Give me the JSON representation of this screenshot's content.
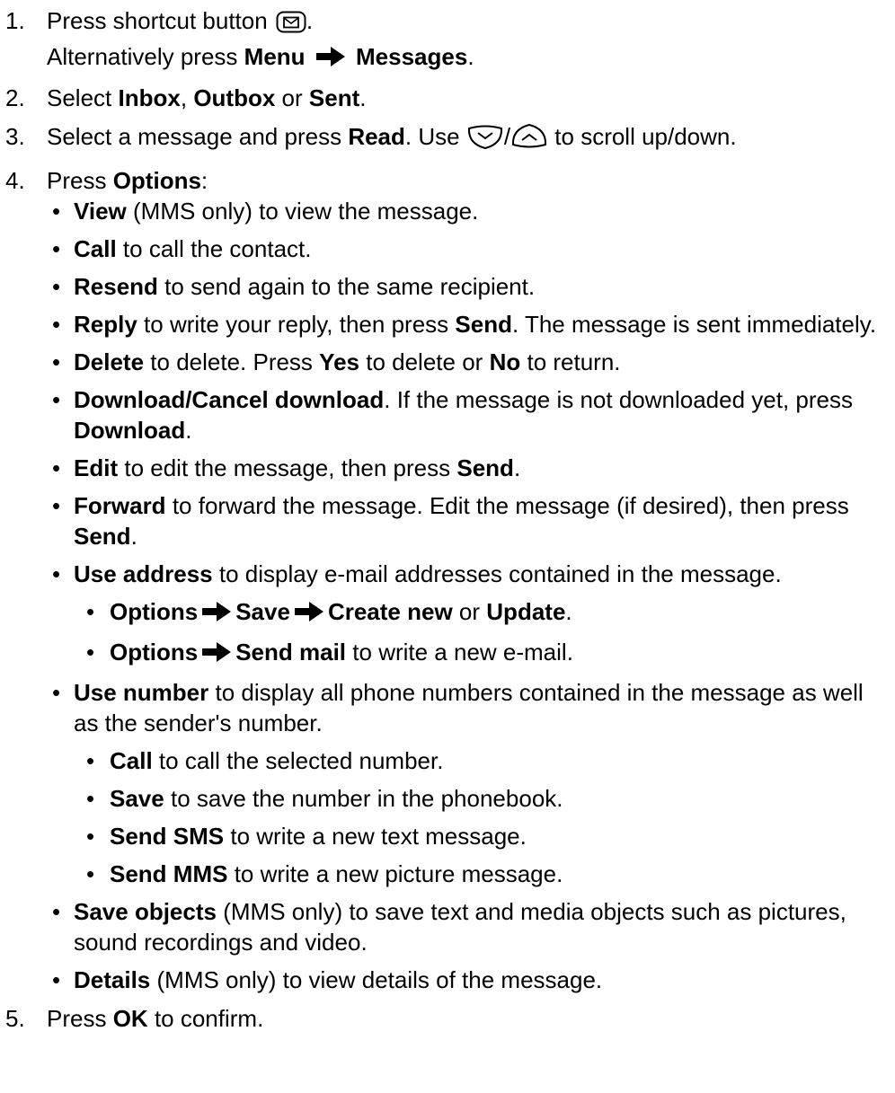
{
  "s1": {
    "num": "1.",
    "t1": "Press shortcut button",
    "t2": ".",
    "l2a": "Alternatively press",
    "menu": "Menu",
    "messages": "Messages",
    "l2end": "."
  },
  "s2": {
    "num": "2.",
    "t1": "Select",
    "inbox": "Inbox",
    "c": ",",
    "outbox": "Outbox",
    "or": "or",
    "sent": "Sent",
    "end": "."
  },
  "s3": {
    "num": "3.",
    "t1": "Select a message and press",
    "read": "Read",
    "t2": ". Use",
    "slash": "/",
    "t3": "to scroll up/down."
  },
  "s4": {
    "num": "4.",
    "t1": "Press",
    "options": "Options",
    "colon": ":"
  },
  "opts": {
    "view_b": "View",
    "view_t": "(MMS only) to view the message.",
    "call_b": "Call",
    "call_t": "to call the contact.",
    "resend_b": "Resend",
    "resend_t": "to send again to the same recipient.",
    "reply_b": "Reply",
    "reply_t1": "to write your reply, then press",
    "reply_send": "Send",
    "reply_t2": ". The message is sent immediately.",
    "delete_b": "Delete",
    "delete_t1": "to delete. Press",
    "delete_yes": "Yes",
    "delete_t2": "to delete or",
    "delete_no": "No",
    "delete_t3": "to return.",
    "download_b": "Download/Cancel download",
    "download_t1": ". If the message is not downloaded yet, press",
    "download_b2": "Download",
    "download_t2": ".",
    "edit_b": "Edit",
    "edit_t1": "to edit the message, then press",
    "edit_send": "Send",
    "edit_t2": ".",
    "forward_b": "Forward",
    "forward_t1": "to forward the message. Edit the message (if desired), then press",
    "forward_send": "Send",
    "forward_t2": ".",
    "useaddr_b": "Use address",
    "useaddr_t": "to display e-mail addresses contained in the message.",
    "sub1_options": "Options",
    "sub1_save": "Save",
    "sub1_create": "Create new",
    "sub1_or": "or",
    "sub1_update": "Update",
    "sub1_end": ".",
    "sub2_options": "Options",
    "sub2_sendmail": "Send mail",
    "sub2_t": "to write a new e-mail.",
    "usenum_b": "Use number",
    "usenum_t": "to display all phone numbers contained in the message as well as the sender's number.",
    "n_call_b": "Call",
    "n_call_t": "to call the selected number.",
    "n_save_b": "Save",
    "n_save_t": "to save the number in the phonebook.",
    "n_sms_b": "Send SMS",
    "n_sms_t": "to write a new text message.",
    "n_mms_b": "Send MMS",
    "n_mms_t": "to write a new picture message.",
    "saveobj_b": "Save objects",
    "saveobj_t": "(MMS only) to save text and media objects such as pictures, sound recordings and video.",
    "details_b": "Details",
    "details_t": "(MMS only) to view details of the message."
  },
  "s5": {
    "num": "5.",
    "t1": "Press",
    "ok": "OK",
    "t2": "to confirm."
  },
  "bullet": "•",
  "icons": {
    "shortcut": "envelope-key-icon",
    "arrow": "right-arrow-icon",
    "down": "nav-down-key-icon",
    "up": "nav-up-key-icon"
  }
}
